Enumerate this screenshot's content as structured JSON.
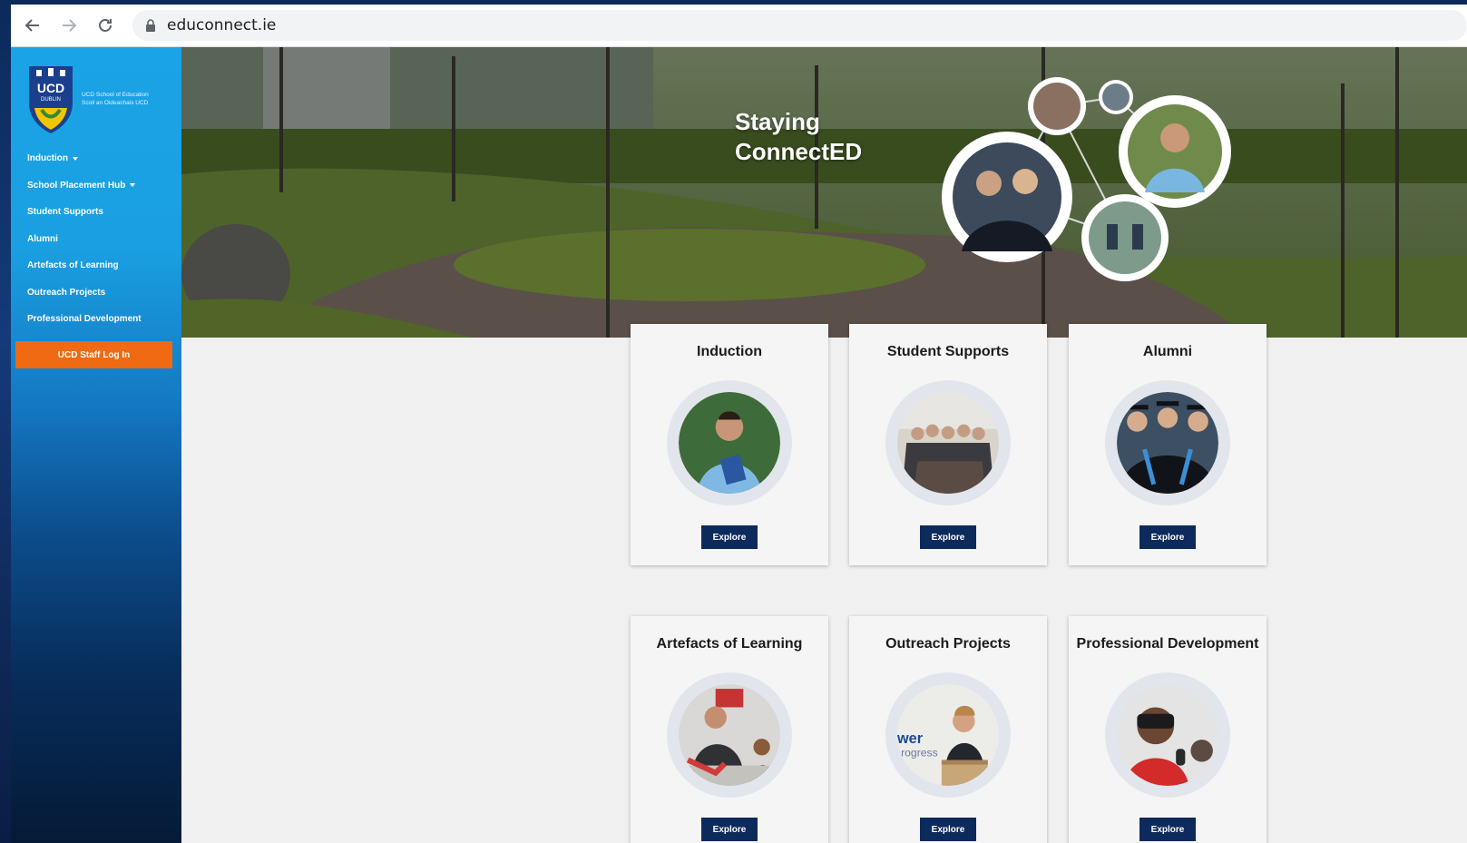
{
  "browser": {
    "url": "educonnect.ie",
    "back_icon": "arrow-left-icon",
    "forward_icon": "arrow-right-icon",
    "reload_icon": "reload-icon",
    "lock_icon": "lock-icon"
  },
  "sidebar": {
    "logo": {
      "wordmark": "UCD",
      "sub": "DUBLIN",
      "line1": "UCD School of Education",
      "line2": "Scoil an Oideachais UCD"
    },
    "items": [
      {
        "label": "Induction",
        "dropdown": true
      },
      {
        "label": "School Placement Hub",
        "dropdown": true
      },
      {
        "label": "Student Supports",
        "dropdown": false
      },
      {
        "label": "Alumni",
        "dropdown": false
      },
      {
        "label": "Artefacts of Learning",
        "dropdown": false
      },
      {
        "label": "Outreach Projects",
        "dropdown": false
      },
      {
        "label": "Professional Development",
        "dropdown": false
      }
    ],
    "staff_login": "UCD Staff Log In"
  },
  "hero": {
    "title_line1": "Staying",
    "title_line2": "ConnectED"
  },
  "cards": [
    {
      "title": "Induction",
      "button": "Explore",
      "photo": "student-with-book-photo"
    },
    {
      "title": "Student Supports",
      "button": "Explore",
      "photo": "group-photo"
    },
    {
      "title": "Alumni",
      "button": "Explore",
      "photo": "graduates-photo"
    },
    {
      "title": "Artefacts of Learning",
      "button": "Explore",
      "photo": "classroom-photo"
    },
    {
      "title": "Outreach Projects",
      "button": "Explore",
      "photo": "speaker-at-podium-photo"
    },
    {
      "title": "Professional Development",
      "button": "Explore",
      "photo": "vr-headset-photo"
    }
  ],
  "colors": {
    "sidebar_top": "#1aa3e6",
    "sidebar_bottom": "#051a36",
    "staff_button": "#ef6a12",
    "explore_button": "#0d2a5c"
  }
}
